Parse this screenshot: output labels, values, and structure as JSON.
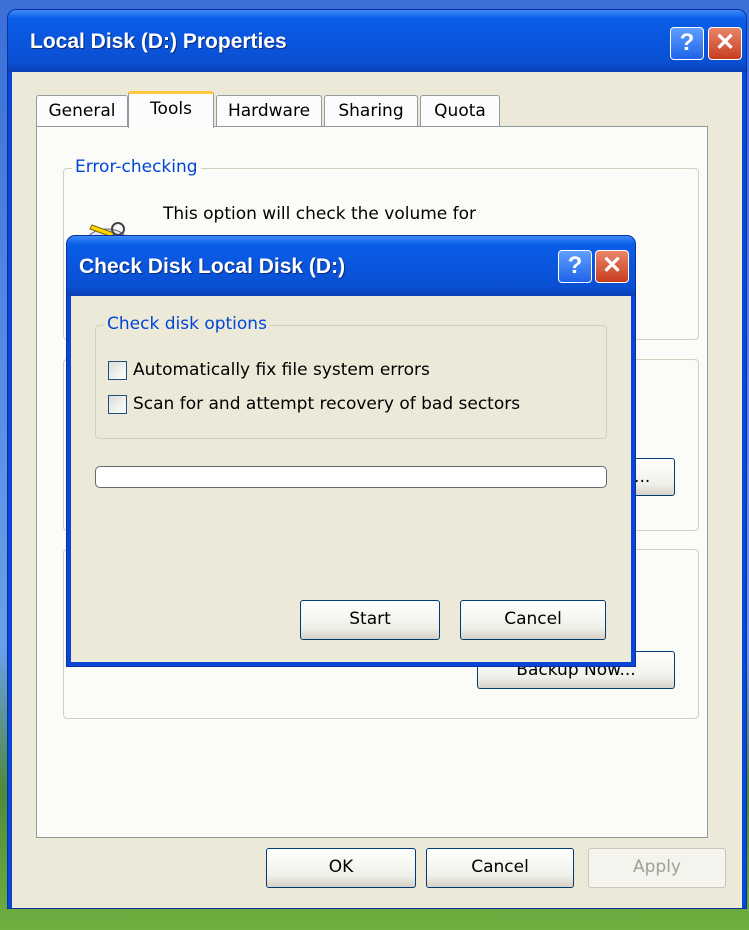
{
  "main_window": {
    "title": "Local Disk (D:) Properties",
    "help_button": "?",
    "close_button": "✕",
    "tabs": [
      {
        "label": "General"
      },
      {
        "label": "Tools"
      },
      {
        "label": "Hardware"
      },
      {
        "label": "Sharing"
      },
      {
        "label": "Quota"
      }
    ],
    "active_tab": "Tools",
    "error_checking": {
      "group_label": "Error-checking",
      "description": "This option will check the volume for"
    },
    "defrag_button_partial": "w...",
    "backup_button": "Backup Now...",
    "footer": {
      "ok_label": "OK",
      "cancel_label": "Cancel",
      "apply_label": "Apply"
    }
  },
  "dialog": {
    "title": "Check Disk Local Disk (D:)",
    "help_button": "?",
    "close_button": "✕",
    "options_group_label": "Check disk options",
    "options": [
      {
        "label": "Automatically fix file system errors",
        "checked": false
      },
      {
        "label": "Scan for and attempt recovery of bad sectors",
        "checked": false
      }
    ],
    "progress": 0,
    "start_label": "Start",
    "cancel_label": "Cancel"
  },
  "colors": {
    "title_blue": "#0a55dd",
    "group_label_blue": "#0046d5",
    "face": "#ece9d8",
    "close_red": "#c83d1f"
  }
}
